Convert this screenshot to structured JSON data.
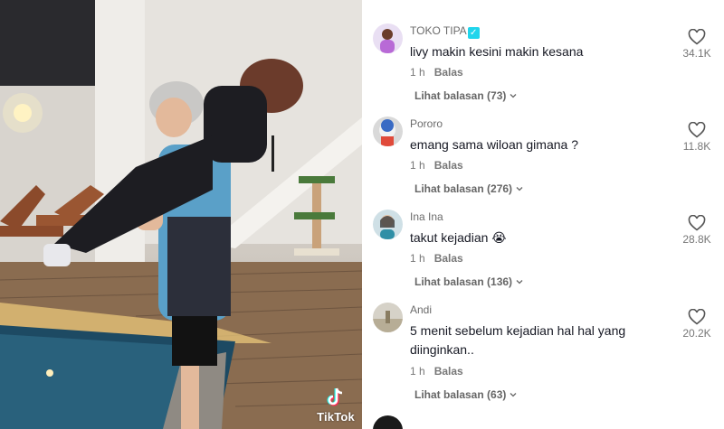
{
  "video": {
    "watermark": "TikTok"
  },
  "comments": [
    {
      "username": "TOKO TIPA",
      "verified": true,
      "text": "livy makin kesini makin kesana",
      "time": "1 h",
      "reply_label": "Balas",
      "view_replies": "Lihat balasan (73)",
      "likes": "34.1K"
    },
    {
      "username": "Pororo",
      "text": "emang sama wiloan gimana ?",
      "time": "1 h",
      "reply_label": "Balas",
      "view_replies": "Lihat balasan (276)",
      "likes": "11.8K"
    },
    {
      "username": "Ina Ina",
      "text": "takut kejadian 😭",
      "time": "1 h",
      "reply_label": "Balas",
      "view_replies": "Lihat balasan (136)",
      "likes": "28.8K"
    },
    {
      "username": "Andi",
      "text": "5 menit sebelum kejadian hal hal yang diinginkan..",
      "time": "1 h",
      "reply_label": "Balas",
      "view_replies": "Lihat balasan (63)",
      "likes": "20.2K"
    }
  ],
  "colors": {
    "verified_badge": "#20d5ec",
    "text_primary": "#161823",
    "text_secondary": "#777777"
  },
  "icons": {
    "like": "heart-outline-icon",
    "expand": "chevron-down-icon",
    "watermark": "tiktok-logo-icon"
  }
}
